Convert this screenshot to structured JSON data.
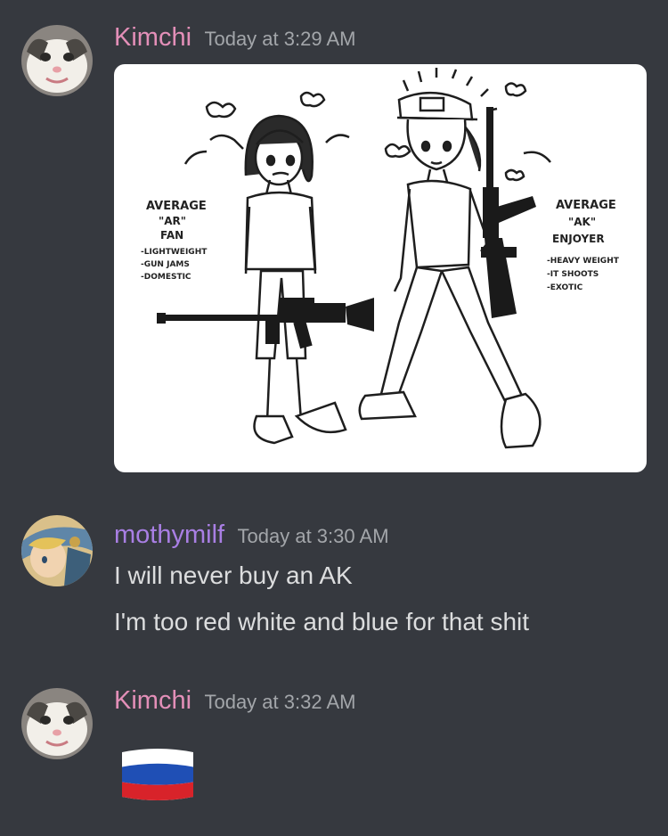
{
  "messages": [
    {
      "username": "Kimchi",
      "timestamp": "Today at 3:29 AM",
      "username_color": "#e38fb8",
      "attachment": {
        "left_caption": [
          "AVERAGE",
          "\"AR\"",
          "FAN",
          "-LIGHTWEIGHT",
          "-GUN JAMS",
          "-DOMESTIC"
        ],
        "right_caption": [
          "AVERAGE",
          "\"AK\"",
          "ENJOYER",
          "-HEAVY WEIGHT",
          "-IT SHOOTS",
          "-EXOTIC"
        ]
      }
    },
    {
      "username": "mothymilf",
      "timestamp": "Today at 3:30 AM",
      "username_color": "#a97fe4",
      "lines": [
        "I will never buy an AK",
        "I'm too red white and blue for that shit"
      ]
    },
    {
      "username": "Kimchi",
      "timestamp": "Today at 3:32 AM",
      "username_color": "#e38fb8",
      "emoji": "russia-flag"
    }
  ],
  "colors": {
    "background": "#36393f",
    "text": "#dcddde",
    "timestamp": "#a3a6aa"
  }
}
